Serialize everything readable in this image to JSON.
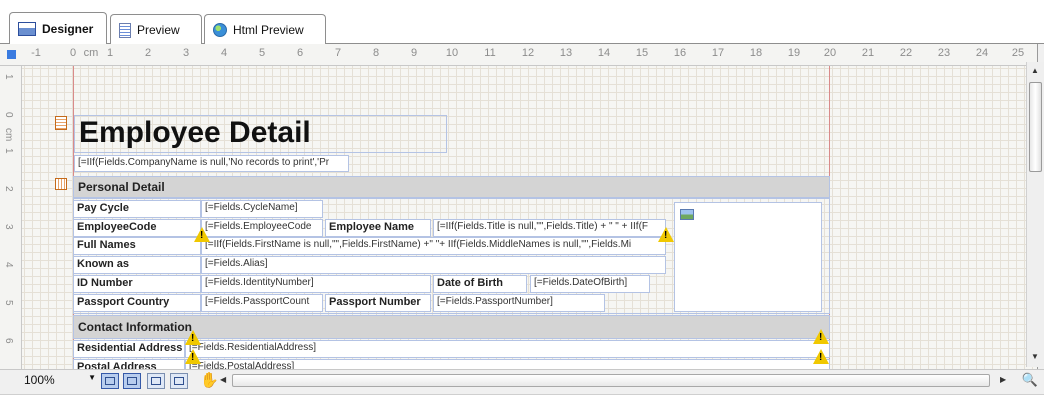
{
  "tabs": [
    {
      "label": "Designer",
      "icon": "designer-icon",
      "active": true
    },
    {
      "label": "Preview",
      "icon": "preview-icon",
      "active": false
    },
    {
      "label": "Html Preview",
      "icon": "globe-icon",
      "active": false
    }
  ],
  "ruler": {
    "unit": "cm",
    "labels": [
      "-1",
      "0",
      "cm",
      "1",
      "2",
      "3",
      "4",
      "5",
      "6",
      "7",
      "8",
      "9",
      "10",
      "11",
      "12",
      "13",
      "14",
      "15",
      "16",
      "17",
      "18",
      "19",
      "20",
      "21",
      "22",
      "23",
      "24",
      "25"
    ],
    "vlabels": [
      "1",
      "0",
      "cm",
      "1",
      "2",
      "3",
      "4",
      "5",
      "6"
    ]
  },
  "report": {
    "title": "Employee Detail",
    "company_expr": "[=IIf(Fields.CompanyName is null,'No records to print','Pr",
    "personal_detail": {
      "header": "Personal Detail",
      "pay_cycle_label": "Pay Cycle",
      "pay_cycle_value": "[=Fields.CycleName]",
      "employee_code_label": "EmployeeCode",
      "employee_code_value": "[=Fields.EmployeeCode",
      "employee_name_label": "Employee Name",
      "employee_name_value": "[=IIf(Fields.Title is null,\"\",Fields.Title) + \" \" + IIf(F",
      "full_names_label": "Full Names",
      "full_names_value": "[=IIf(Fields.FirstName is null,\"\",Fields.FirstName) +\" \"+ IIf(Fields.MiddleNames is null,\"\",Fields.Mi",
      "known_as_label": "Known as",
      "known_as_value": "[=Fields.Alias]",
      "id_number_label": "ID Number",
      "id_number_value": "[=Fields.IdentityNumber]",
      "dob_label": "Date of Birth",
      "dob_value": "[=Fields.DateOfBirth]",
      "passport_country_label": "Passport Country",
      "passport_country_value": "[=Fields.PassportCount",
      "passport_number_label": "Passport Number",
      "passport_number_value": "[=Fields.PassportNumber]"
    },
    "contact_information": {
      "header": "Contact Information",
      "residential_label": "Residential Address",
      "residential_value": "[=Fields.ResidentialAddress]",
      "postal_label": "Postal Address",
      "postal_value": "[=Fields.PostalAddress]"
    }
  },
  "toolbar": {
    "zoom": "100%"
  },
  "colors": {
    "accent": "#f5c500",
    "section_header": "#d4d4d4",
    "cell_border": "#b4c3e4",
    "margin_line": "#d98a8a",
    "warning": "#f0c800"
  }
}
